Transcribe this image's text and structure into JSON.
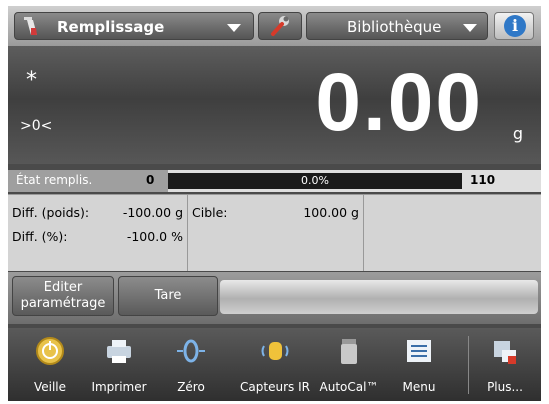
{
  "topbar": {
    "mode_label": "Remplissage",
    "library_label": "Bibliothèque",
    "info_glyph": "i"
  },
  "display": {
    "stable_indicator": "*",
    "zero_indicator": ">0<",
    "weight": "0.00",
    "unit": "g"
  },
  "fill_state": {
    "label": "État remplis.",
    "min": "0",
    "max": "110",
    "percent_text": "0.0%",
    "progress_fraction": 0.0
  },
  "info": {
    "diff_weight_label": "Diff. (poids):",
    "diff_weight_value": "-100.00 g",
    "diff_pct_label": "Diff. (%):",
    "diff_pct_value": "-100.0 %",
    "target_label": "Cible:",
    "target_value": "100.00 g"
  },
  "actions": {
    "edit_line1": "Editer",
    "edit_line2": "paramétrage",
    "tare": "Tare"
  },
  "dock": [
    {
      "label": "Veille",
      "icon": "standby-icon"
    },
    {
      "label": "Imprimer",
      "icon": "printer-icon"
    },
    {
      "label": "Zéro",
      "icon": "zero-icon"
    },
    {
      "label": "Capteurs IR",
      "icon": "ir-sensor-hand-icon"
    },
    {
      "label": "AutoCal™",
      "icon": "autocal-weight-icon"
    },
    {
      "label": "Menu",
      "icon": "menu-list-icon"
    },
    {
      "label": "Plus...",
      "icon": "more-icon"
    }
  ],
  "colors": {
    "progress_fill": "#f2a000",
    "info_blue": "#2f78c7"
  }
}
